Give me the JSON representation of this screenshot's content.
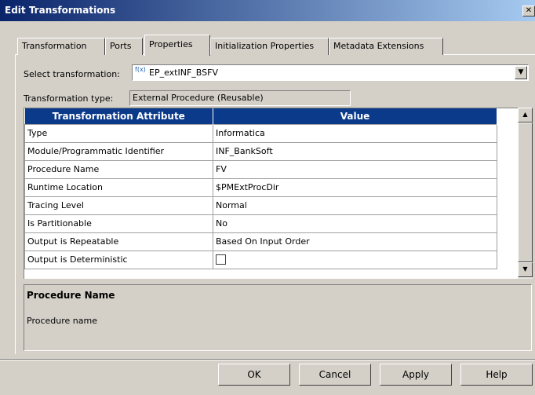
{
  "window": {
    "title": "Edit Transformations",
    "close_glyph": "✕"
  },
  "tabs": [
    {
      "label": "Transformation",
      "active": false
    },
    {
      "label": "Ports",
      "active": false
    },
    {
      "label": "Properties",
      "active": true
    },
    {
      "label": "Initialization Properties",
      "active": false
    },
    {
      "label": "Metadata Extensions",
      "active": false
    }
  ],
  "select_transformation": {
    "label": "Select transformation:",
    "value": "EP_extINF_BSFV",
    "icon": "procedure-icon",
    "icon_text": "f(x)"
  },
  "transformation_type": {
    "label": "Transformation type:",
    "value": "External Procedure (Reusable)"
  },
  "grid": {
    "columns": [
      "Transformation Attribute",
      "Value"
    ],
    "rows": [
      {
        "attribute": "Type",
        "value": "Informatica"
      },
      {
        "attribute": "Module/Programmatic Identifier",
        "value": "INF_BankSoft"
      },
      {
        "attribute": "Procedure Name",
        "value": "FV"
      },
      {
        "attribute": "Runtime Location",
        "value": "$PMExtProcDir"
      },
      {
        "attribute": "Tracing Level",
        "value": "Normal"
      },
      {
        "attribute": "Is Partitionable",
        "value": "No"
      },
      {
        "attribute": "Output is Repeatable",
        "value": "Based On Input Order"
      },
      {
        "attribute": "Output is Deterministic",
        "value": "",
        "checkbox": true,
        "checked": false
      }
    ],
    "header_color": "#0b3a8a"
  },
  "description": {
    "title": "Procedure Name",
    "text": "Procedure name"
  },
  "buttons": {
    "ok": "OK",
    "cancel": "Cancel",
    "apply": "Apply",
    "help": "Help"
  },
  "scroll_glyphs": {
    "up": "▲",
    "down": "▼"
  }
}
